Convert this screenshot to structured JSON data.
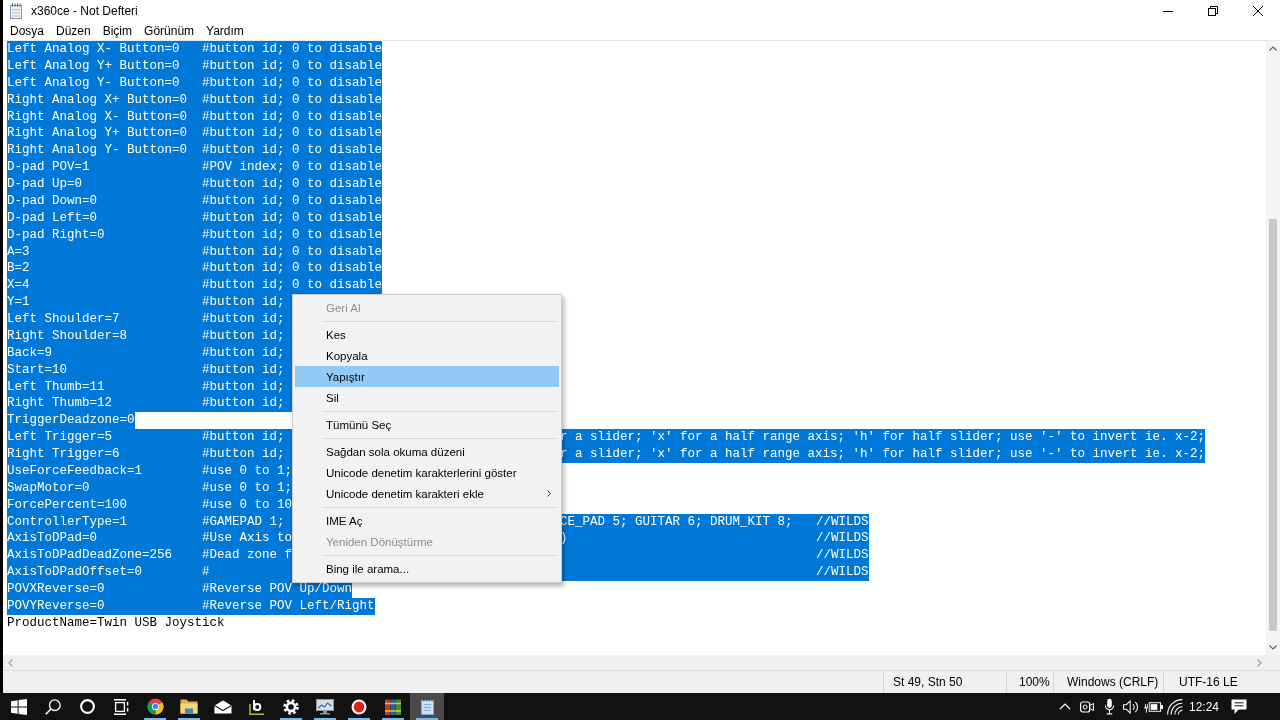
{
  "window": {
    "title": "x360ce - Not Defteri"
  },
  "menu_bar": [
    "Dosya",
    "Düzen",
    "Biçim",
    "Görünüm",
    "Yardım"
  ],
  "editor": {
    "lines": [
      {
        "setting": "Left Analog X- Button=0",
        "comment": "#button id; 0 to disable",
        "selected": true
      },
      {
        "setting": "Left Analog Y+ Button=0",
        "comment": "#button id; 0 to disable",
        "selected": true
      },
      {
        "setting": "Left Analog Y- Button=0",
        "comment": "#button id; 0 to disable",
        "selected": true
      },
      {
        "setting": "Right Analog X+ Button=0",
        "comment": "#button id; 0 to disable",
        "selected": true
      },
      {
        "setting": "Right Analog X- Button=0",
        "comment": "#button id; 0 to disable",
        "selected": true
      },
      {
        "setting": "Right Analog Y+ Button=0",
        "comment": "#button id; 0 to disable",
        "selected": true
      },
      {
        "setting": "Right Analog Y- Button=0",
        "comment": "#button id; 0 to disable",
        "selected": true
      },
      {
        "setting": "D-pad POV=1",
        "comment": "#POV index; 0 to disable",
        "selected": true
      },
      {
        "setting": "D-pad Up=0",
        "comment": "#button id; 0 to disable",
        "selected": true
      },
      {
        "setting": "D-pad Down=0",
        "comment": "#button id; 0 to disable",
        "selected": true
      },
      {
        "setting": "D-pad Left=0",
        "comment": "#button id; 0 to disable",
        "selected": true
      },
      {
        "setting": "D-pad Right=0",
        "comment": "#button id; 0 to disable",
        "selected": true
      },
      {
        "setting": "A=3",
        "comment": "#button id; 0 to disable",
        "selected": true
      },
      {
        "setting": "B=2",
        "comment": "#button id; 0 to disable",
        "selected": true
      },
      {
        "setting": "X=4",
        "comment": "#button id; 0 to disable",
        "selected": true
      },
      {
        "setting": "Y=1",
        "comment": "#button id;",
        "selected": true
      },
      {
        "setting": "Left Shoulder=7",
        "comment": "#button id;",
        "selected": true
      },
      {
        "setting": "Right Shoulder=8",
        "comment": "#button id;",
        "selected": true
      },
      {
        "setting": "Back=9",
        "comment": "#button id;",
        "selected": true
      },
      {
        "setting": "Start=10",
        "comment": "#button id;",
        "selected": true
      },
      {
        "setting": "Left Thumb=11",
        "comment": "#button id;",
        "selected": true
      },
      {
        "setting": "Right Thumb=12",
        "comment": "#button id;",
        "selected": true
      },
      {
        "setting": "TriggerDeadzone=0",
        "selected": true
      },
      {
        "setting": "Left Trigger=5",
        "comment": "#button id;",
        "tail": "r a slider; 'x' for a half range axis; 'h' for half slider; use '-' to invert ie. x-2;",
        "selected": true
      },
      {
        "setting": "Right Trigger=6",
        "comment": "#button id;",
        "tail": "r a slider; 'x' for a half range axis; 'h' for half slider; use '-' to invert ie. x-2;",
        "selected": true
      },
      {
        "setting": "UseForceFeedback=1",
        "comment": "#use 0 to 1;",
        "selected": true
      },
      {
        "setting": "SwapMotor=0",
        "comment": "#use 0 to 1;",
        "selected": true
      },
      {
        "setting": "ForcePercent=100",
        "comment": "#use 0 to 10",
        "selected": true
      },
      {
        "setting": "ControllerType=1",
        "comment": "#GAMEPAD 1;",
        "tail": "CE_PAD 5; GUITAR 6; DRUM_KIT 8;",
        "note": "//WILDS",
        "selected": true
      },
      {
        "setting": "AxisToDPad=0",
        "comment": "#Use Axis to",
        "tail": ")",
        "note": "//WILDS",
        "selected": true
      },
      {
        "setting": "AxisToDPadDeadZone=256",
        "comment": "#Dead zone f",
        "note": "//WILDS",
        "selected": true
      },
      {
        "setting": "AxisToDPadOffset=0",
        "comment": "#",
        "note": "//WILDS",
        "selected": true
      },
      {
        "setting": "POVXReverse=0",
        "comment": "#Reverse POV Up/Down",
        "selected": true
      },
      {
        "setting": "POVYReverse=0",
        "comment": "#Reverse POV Left/Right",
        "selected": true
      },
      {
        "setting": "ProductName=Twin USB Joystick",
        "selected": false
      }
    ]
  },
  "context_menu": {
    "items": [
      {
        "kind": "item",
        "label": "Geri Al",
        "disabled": true,
        "selected": false,
        "submenu": false
      },
      {
        "kind": "separator"
      },
      {
        "kind": "item",
        "label": "Kes",
        "disabled": false,
        "selected": false,
        "submenu": false
      },
      {
        "kind": "item",
        "label": "Kopyala",
        "disabled": false,
        "selected": false,
        "submenu": false
      },
      {
        "kind": "item",
        "label": "Yapıştır",
        "disabled": false,
        "selected": true,
        "submenu": false
      },
      {
        "kind": "item",
        "label": "Sil",
        "disabled": false,
        "selected": false,
        "submenu": false
      },
      {
        "kind": "separator"
      },
      {
        "kind": "item",
        "label": "Tümünü Seç",
        "disabled": false,
        "selected": false,
        "submenu": false
      },
      {
        "kind": "separator"
      },
      {
        "kind": "item",
        "label": "Sağdan sola okuma düzeni",
        "disabled": false,
        "selected": false,
        "submenu": false
      },
      {
        "kind": "item",
        "label": "Unicode denetim karakterlerini göster",
        "disabled": false,
        "selected": false,
        "submenu": false
      },
      {
        "kind": "item",
        "label": "Unicode denetim karakteri ekle",
        "disabled": false,
        "selected": false,
        "submenu": true
      },
      {
        "kind": "separator"
      },
      {
        "kind": "item",
        "label": "IME Aç",
        "disabled": false,
        "selected": false,
        "submenu": false
      },
      {
        "kind": "item",
        "label": "Yeniden Dönüştürme",
        "disabled": true,
        "selected": false,
        "submenu": false
      },
      {
        "kind": "separator"
      },
      {
        "kind": "item",
        "label": "Bing ile arama...",
        "disabled": false,
        "selected": false,
        "submenu": false
      }
    ]
  },
  "status_bar": {
    "position": "St 49, Stn 50",
    "zoom": "100%",
    "line_ending": "Windows (CRLF)",
    "encoding": "UTF-16 LE"
  },
  "taskbar": {
    "apps": [
      {
        "kind": "browser",
        "running": true,
        "selected": false
      },
      {
        "kind": "folder",
        "running": true,
        "selected": false
      },
      {
        "kind": "mail",
        "running": false,
        "selected": false
      },
      {
        "kind": "b-logo",
        "running": false,
        "selected": false
      },
      {
        "kind": "gear",
        "running": true,
        "selected": false
      },
      {
        "kind": "monitor",
        "running": true,
        "selected": false
      },
      {
        "kind": "record",
        "running": true,
        "selected": false
      },
      {
        "kind": "books",
        "running": true,
        "selected": false
      },
      {
        "kind": "notepad",
        "running": true,
        "selected": true
      }
    ],
    "clock": "12:24"
  }
}
